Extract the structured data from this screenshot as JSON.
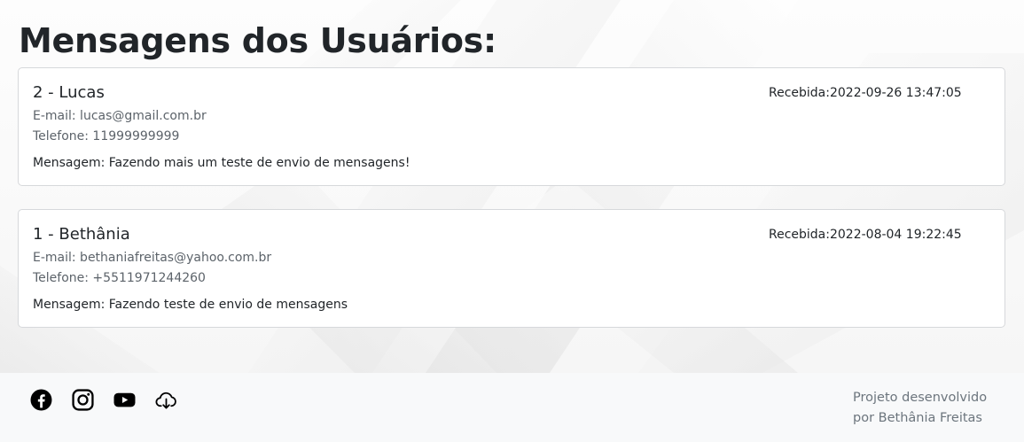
{
  "page": {
    "heading": "Mensagens dos Usuários:"
  },
  "messages": [
    {
      "title": "2 - Lucas",
      "received": "Recebida:2022-09-26 13:47:05",
      "email": "E-mail: lucas@gmail.com.br",
      "phone": "Telefone: 11999999999",
      "message": "Mensagem: Fazendo mais um teste de envio de mensagens!"
    },
    {
      "title": "1 - Bethânia",
      "received": "Recebida:2022-08-04 19:22:45",
      "email": "E-mail: bethaniafreitas@yahoo.com.br",
      "phone": "Telefone: +5511971244260",
      "message": "Mensagem: Fazendo teste de envio de mensagens"
    }
  ],
  "footer": {
    "icons": [
      "facebook-icon",
      "instagram-icon",
      "youtube-icon",
      "cloud-download-icon"
    ],
    "credit_line1": "Projeto desenvolvido",
    "credit_line2": "por Bethânia Freitas"
  }
}
